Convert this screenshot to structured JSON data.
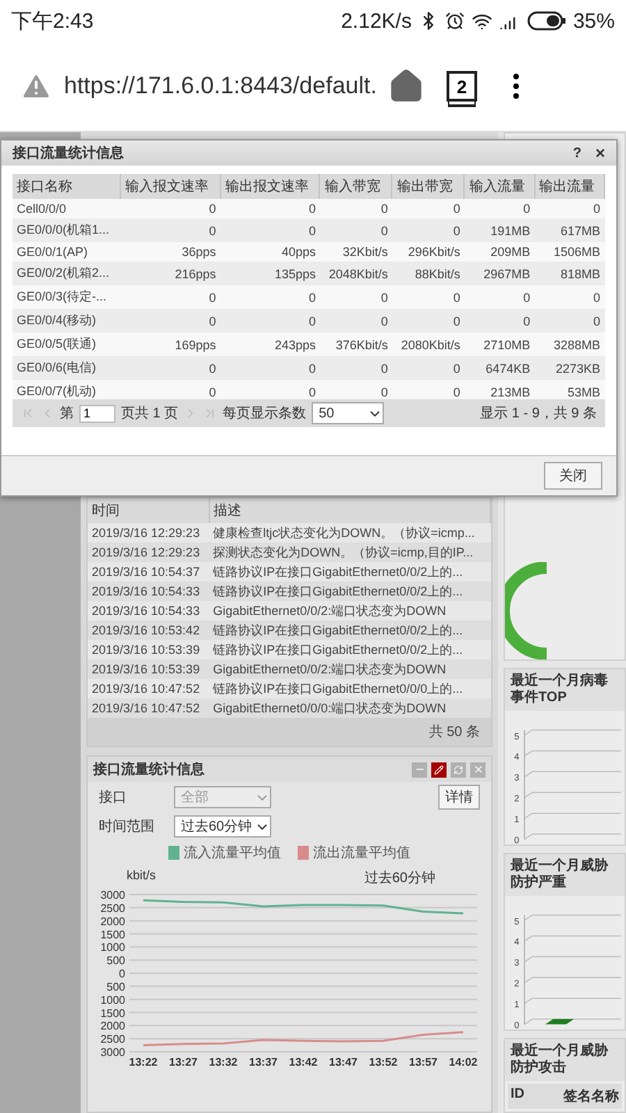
{
  "status_bar": {
    "time": "下午2:43",
    "net_speed": "2.12K/s",
    "battery": "35%"
  },
  "browser": {
    "url": "https://171.6.0.1:8443/default.",
    "tab_count": "2"
  },
  "dialog": {
    "title": "接口流量统计信息",
    "help": "?",
    "close": "×",
    "columns": [
      "接口名称",
      "输入报文速率",
      "输出报文速率",
      "输入带宽",
      "输出带宽",
      "输入流量",
      "输出流量"
    ],
    "rows": [
      [
        "Cell0/0/0",
        "0",
        "0",
        "0",
        "0",
        "0",
        "0"
      ],
      [
        "GE0/0/0(机箱1...",
        "0",
        "0",
        "0",
        "0",
        "191MB",
        "617MB"
      ],
      [
        "GE0/0/1(AP)",
        "36pps",
        "40pps",
        "32Kbit/s",
        "296Kbit/s",
        "209MB",
        "1506MB"
      ],
      [
        "GE0/0/2(机箱2...",
        "216pps",
        "135pps",
        "2048Kbit/s",
        "88Kbit/s",
        "2967MB",
        "818MB"
      ],
      [
        "GE0/0/3(待定-...",
        "0",
        "0",
        "0",
        "0",
        "0",
        "0"
      ],
      [
        "GE0/0/4(移动)",
        "0",
        "0",
        "0",
        "0",
        "0",
        "0"
      ],
      [
        "GE0/0/5(联通)",
        "169pps",
        "243pps",
        "376Kbit/s",
        "2080Kbit/s",
        "2710MB",
        "3288MB"
      ],
      [
        "GE0/0/6(电信)",
        "0",
        "0",
        "0",
        "0",
        "6474KB",
        "2273KB"
      ],
      [
        "GE0/0/7(机动)",
        "0",
        "0",
        "0",
        "0",
        "213MB",
        "53MB"
      ]
    ],
    "pager": {
      "page_prefix": "第",
      "page": "1",
      "page_suffix": "页共 1 页",
      "per_page_label": "每页显示条数",
      "per_page": "50",
      "summary": "显示 1 - 9，共 9 条"
    },
    "buttons": [
      "关闭"
    ]
  },
  "log_panel": {
    "columns": [
      "时间",
      "描述"
    ],
    "rows": [
      {
        "time": "2019/3/16 12:29:23",
        "description": "健康检查ltjc状态变化为DOWN。（协议=icmp..."
      },
      {
        "time": "2019/3/16 12:29:23",
        "description": "探测状态变化为DOWN。（协议=icmp,目的IP..."
      },
      {
        "time": "2019/3/16 10:54:37",
        "description": "链路协议IP在接口GigabitEthernet0/0/2上的..."
      },
      {
        "time": "2019/3/16 10:54:33",
        "description": "链路协议IP在接口GigabitEthernet0/0/2上的..."
      },
      {
        "time": "2019/3/16 10:54:33",
        "description": "GigabitEthernet0/0/2:端口状态变为DOWN"
      },
      {
        "time": "2019/3/16 10:53:42",
        "description": "链路协议IP在接口GigabitEthernet0/0/2上的..."
      },
      {
        "time": "2019/3/16 10:53:39",
        "description": "链路协议IP在接口GigabitEthernet0/0/2上的..."
      },
      {
        "time": "2019/3/16 10:53:39",
        "description": "GigabitEthernet0/0/2:端口状态变为DOWN"
      },
      {
        "time": "2019/3/16 10:47:52",
        "description": "链路协议IP在接口GigabitEthernet0/0/0上的..."
      },
      {
        "time": "2019/3/16 10:47:52",
        "description": "GigabitEthernet0/0/0:端口状态变为DOWN"
      }
    ],
    "footer": "共 50 条"
  },
  "traffic_panel": {
    "title": "接口流量统计信息",
    "interface_label": "接口",
    "interface": {
      "value": "全部",
      "disabled": true
    },
    "detail_button": "详情",
    "range_label": "时间范围",
    "range": {
      "value": "过去60分钟",
      "disabled": false
    },
    "chart_data": {
      "type": "line",
      "grid": true,
      "title": "过去60分钟",
      "ylabel": "kbit/s",
      "x": [
        "13:22",
        "13:27",
        "13:32",
        "13:37",
        "13:42",
        "13:47",
        "13:52",
        "13:57",
        "14:02"
      ],
      "series": [
        {
          "name": "流入流量平均值",
          "color": "#5fb38f",
          "values": [
            2780,
            2720,
            2700,
            2550,
            2600,
            2600,
            2580,
            2350,
            2280
          ]
        },
        {
          "name": "流出流量平均值",
          "color": "#d98c8c",
          "values": [
            -2750,
            -2700,
            -2680,
            -2550,
            -2580,
            -2600,
            -2580,
            -2350,
            -2250
          ]
        }
      ],
      "ylim": [
        -3000,
        3000
      ],
      "yticks": [
        {
          "value": 3000,
          "label": "3000"
        },
        {
          "value": 2500,
          "label": "2500"
        },
        {
          "value": 2000,
          "label": "2000"
        },
        {
          "value": 1500,
          "label": "1500"
        },
        {
          "value": 1000,
          "label": "1000"
        },
        {
          "value": 500,
          "label": "500"
        },
        {
          "value": 0,
          "label": "0"
        },
        {
          "value": -500,
          "label": "500"
        },
        {
          "value": -1000,
          "label": "1000"
        },
        {
          "value": -1500,
          "label": "1500"
        },
        {
          "value": -2000,
          "label": "2000"
        },
        {
          "value": -2500,
          "label": "2500"
        },
        {
          "value": -3000,
          "label": "3000"
        }
      ]
    }
  },
  "right_panels": [
    {
      "kind": "chart",
      "title": "最近一个月病毒事件TOP",
      "ticks": [
        "5",
        "4",
        "3",
        "2",
        "1",
        "0"
      ]
    },
    {
      "kind": "chart",
      "title": "最近一个月威胁防护严重",
      "ticks": [
        "5",
        "4",
        "3",
        "2",
        "1",
        "0"
      ]
    },
    {
      "kind": "table",
      "title": "最近一个月威胁防护攻击",
      "columns": [
        "ID",
        "签名名称"
      ]
    }
  ]
}
